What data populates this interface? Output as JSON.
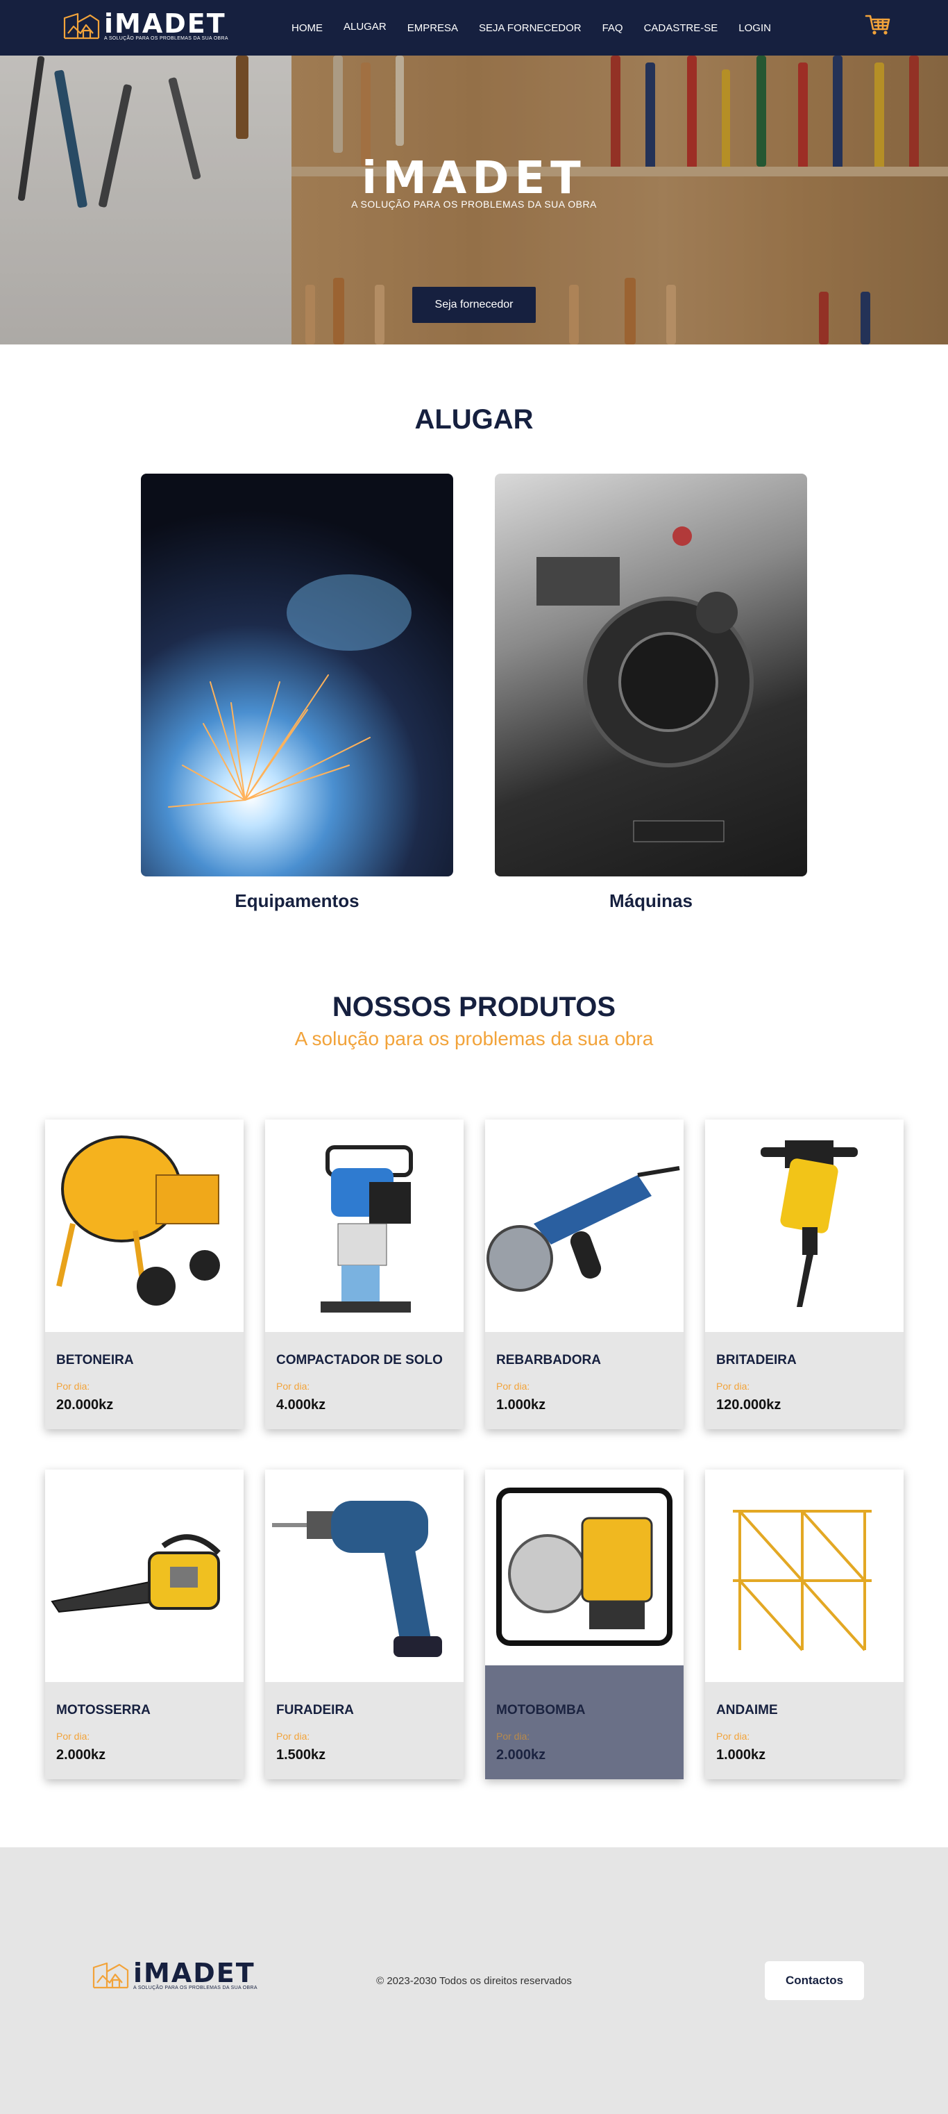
{
  "brand": {
    "name": "iMADET",
    "tagline": "A SOLUÇÃO PARA OS PROBLEMAS DA SUA OBRA",
    "colors": {
      "navy": "#16203f",
      "orange": "#f2a33a",
      "footer_bg": "#e5e5e5"
    }
  },
  "nav": {
    "items": [
      "HOME",
      "ALUGAR",
      "EMPRESA",
      "SEJA FORNECEDOR",
      "FAQ",
      "CADASTRE-SE",
      "LOGIN"
    ],
    "active": "ALUGAR",
    "cart_icon": "shopping-cart-icon"
  },
  "hero": {
    "title": "iMADET",
    "tagline": "A SOLUÇÃO PARA OS PROBLEMAS DA SUA OBRA",
    "button": "Seja fornecedor"
  },
  "rent": {
    "title": "ALUGAR",
    "cards": [
      {
        "label": "Equipamentos",
        "image": "welding-sparks-photo"
      },
      {
        "label": "Máquinas",
        "image": "camera-machinery-photo"
      }
    ]
  },
  "products": {
    "title": "NOSSOS PRODUTOS",
    "subtitle": "A solução para os problemas da sua obra",
    "price_label": "Por dia:",
    "items": [
      {
        "name": "BETONEIRA",
        "price": "20.000kz",
        "image": "concrete-mixer"
      },
      {
        "name": "COMPACTADOR DE SOLO",
        "price": "4.000kz",
        "image": "soil-compactor"
      },
      {
        "name": "REBARBADORA",
        "price": "1.000kz",
        "image": "angle-grinder"
      },
      {
        "name": "BRITADEIRA",
        "price": "120.000kz",
        "image": "jackhammer"
      },
      {
        "name": "MOTOSSERRA",
        "price": "2.000kz",
        "image": "chainsaw"
      },
      {
        "name": "FURADEIRA",
        "price": "1.500kz",
        "image": "drill"
      },
      {
        "name": "MOTOBOMBA",
        "price": "2.000kz",
        "image": "water-pump",
        "highlighted": true
      },
      {
        "name": "ANDAIME",
        "price": "1.000kz",
        "image": "scaffold"
      }
    ]
  },
  "footer": {
    "copyright": "© 2023-2030 Todos os direitos reservados",
    "contact_button": "Contactos"
  }
}
